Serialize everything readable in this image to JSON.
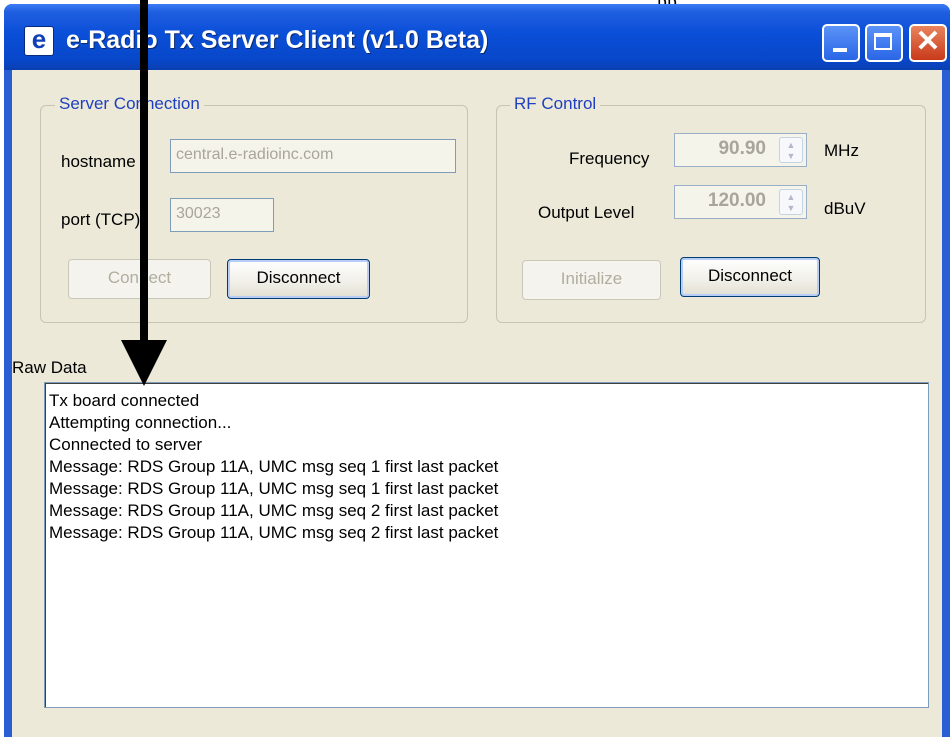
{
  "top_clip_text": "pp",
  "window": {
    "title": "e-Radio Tx Server Client (v1.0 Beta)",
    "app_icon_glyph": "e"
  },
  "server_connection": {
    "legend": "Server Connection",
    "hostname_label": "hostname",
    "hostname_value": "central.e-radioinc.com",
    "port_label": "port (TCP)",
    "port_value": "30023",
    "connect_label": "Connect",
    "disconnect_label": "Disconnect"
  },
  "rf_control": {
    "legend": "RF Control",
    "frequency_label": "Frequency",
    "frequency_value": "90.90",
    "frequency_unit": "MHz",
    "output_label": "Output Level",
    "output_value": "120.00",
    "output_unit": "dBuV",
    "initialize_label": "Initialize",
    "disconnect_label": "Disconnect"
  },
  "raw_data": {
    "label": "Raw Data",
    "lines": [
      "Tx board connected",
      "Attempting connection...",
      "Connected to server",
      "Message: RDS Group 11A, UMC msg seq 1 first last packet",
      "Message: RDS Group 11A, UMC msg seq 1 first last packet",
      "Message: RDS Group 11A, UMC msg seq 2 first last packet",
      "Message: RDS Group 11A, UMC msg seq 2 first last packet"
    ]
  },
  "colors": {
    "titlebar": "#0a4fd8",
    "client_bg": "#ece9d8",
    "legend_text": "#1f3fc0",
    "close_button": "#c9391a"
  },
  "icons": [
    "app-e-icon",
    "minimize-icon",
    "maximize-icon",
    "close-icon",
    "spin-up-icon",
    "spin-down-icon",
    "annotation-arrow"
  ]
}
